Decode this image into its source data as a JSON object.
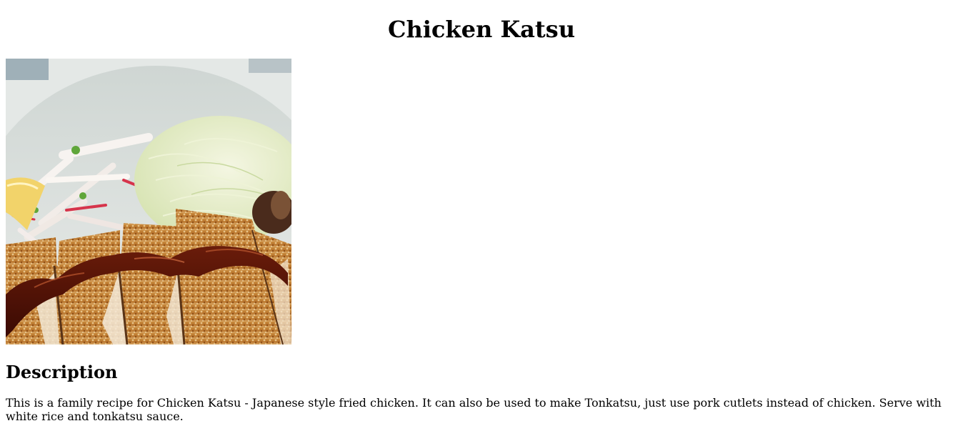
{
  "recipe": {
    "title": "Chicken Katsu",
    "image_alt": "Chicken Katsu",
    "description_heading": "Description",
    "description_text": "This is a family recipe for Chicken Katsu - Japanese style fried chicken. It can also be used to make Tonkatsu, just use pork cutlets instead of chicken. Serve with white rice and tonkatsu sauce."
  },
  "colors": {
    "background": "#ffffff",
    "text": "#000000"
  }
}
